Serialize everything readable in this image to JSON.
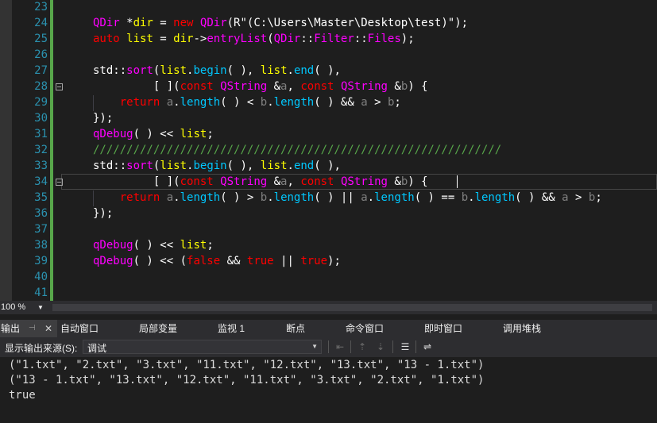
{
  "editor": {
    "line_numbers": [
      "23",
      "24",
      "25",
      "26",
      "27",
      "28",
      "29",
      "30",
      "31",
      "32",
      "33",
      "34",
      "35",
      "36",
      "37",
      "38",
      "39",
      "40",
      "41"
    ],
    "fold_lines": [
      "28",
      "34"
    ]
  },
  "zoom": {
    "value": "100 %"
  },
  "panel_tabs": {
    "output": "输出",
    "autos": "自动窗口",
    "locals": "局部变量",
    "watch1": "监视 1",
    "breakpoints": "断点",
    "command": "命令窗口",
    "immediate": "即时窗口",
    "callstack": "调用堆栈"
  },
  "output_toolbar": {
    "source_label": "显示输出来源(S):",
    "source_value": "调试"
  },
  "output_lines": [
    "(\"1.txt\", \"2.txt\", \"3.txt\", \"11.txt\", \"12.txt\", \"13.txt\", \"13 - 1.txt\")",
    "(\"13 - 1.txt\", \"13.txt\", \"12.txt\", \"11.txt\", \"3.txt\", \"2.txt\", \"1.txt\")",
    "true"
  ],
  "colors": {
    "background": "#1e1e1e",
    "keyword": "#ff0000",
    "type": "#ff00ff",
    "function": "#00c8ff",
    "variable": "#ffff00",
    "parameter": "#808080",
    "comment": "#57a64a",
    "line_number": "#2b91af"
  },
  "code": {
    "l24": {
      "t1": "QDir",
      "t2": " *",
      "t3": "dir",
      "t4": " = ",
      "t5": "new",
      "t6": " ",
      "t7": "QDir",
      "t8": "(R\"(C:\\Users\\Master\\Desktop\\test)\");"
    },
    "l25": {
      "t1": "auto",
      "t2": " ",
      "t3": "list",
      "t4": " = ",
      "t5": "dir",
      "t6": "->",
      "t7": "entryList",
      "t8": "(",
      "t9": "QDir",
      "t10": "::",
      "t11": "Filter",
      "t12": "::",
      "t13": "Files",
      "t14": ");"
    },
    "l27": {
      "t1": "std",
      "t2": "::",
      "t3": "sort",
      "t4": "(",
      "t5": "list",
      "t6": ".",
      "t7": "begin",
      "t8": "( ), ",
      "t9": "list",
      "t10": ".",
      "t11": "end",
      "t12": "( ),"
    },
    "l28": {
      "t1": "         [ ](",
      "t2": "const",
      "t3": " ",
      "t4": "QString",
      "t5": " &",
      "t6": "a",
      "t7": ", ",
      "t8": "const",
      "t9": " ",
      "t10": "QString",
      "t11": " &",
      "t12": "b",
      "t13": ") {"
    },
    "l29": {
      "t1": "    ",
      "t2": "return",
      "t3": " ",
      "t4": "a",
      "t5": ".",
      "t6": "length",
      "t7": "( ) < ",
      "t8": "b",
      "t9": ".",
      "t10": "length",
      "t11": "( ) && ",
      "t12": "a",
      "t13": " > ",
      "t14": "b",
      "t15": ";"
    },
    "l30": {
      "t1": "});"
    },
    "l31": {
      "t1": "qDebug",
      "t2": "( ) << ",
      "t3": "list",
      "t4": ";"
    },
    "l32": {
      "t1": "/////////////////////////////////////////////////////////////"
    },
    "l33": {
      "t1": "std",
      "t2": "::",
      "t3": "sort",
      "t4": "(",
      "t5": "list",
      "t6": ".",
      "t7": "begin",
      "t8": "( ), ",
      "t9": "list",
      "t10": ".",
      "t11": "end",
      "t12": "( ),"
    },
    "l34": {
      "t1": "         [ ](",
      "t2": "const",
      "t3": " ",
      "t4": "QString",
      "t5": " &",
      "t6": "a",
      "t7": ", ",
      "t8": "const",
      "t9": " ",
      "t10": "QString",
      "t11": " &",
      "t12": "b",
      "t13": ") {"
    },
    "l35": {
      "t1": "    ",
      "t2": "return",
      "t3": " ",
      "t4": "a",
      "t5": ".",
      "t6": "length",
      "t7": "( ) > ",
      "t8": "b",
      "t9": ".",
      "t10": "length",
      "t11": "( ) || ",
      "t12": "a",
      "t13": ".",
      "t14": "length",
      "t15": "( ) == ",
      "t16": "b",
      "t17": ".",
      "t18": "length",
      "t19": "( ) && ",
      "t20": "a",
      "t21": " > ",
      "t22": "b",
      "t23": ";"
    },
    "l36": {
      "t1": "});"
    },
    "l38": {
      "t1": "qDebug",
      "t2": "( ) << ",
      "t3": "list",
      "t4": ";"
    },
    "l39": {
      "t1": "qDebug",
      "t2": "( ) << (",
      "t3": "false",
      "t4": " && ",
      "t5": "true",
      "t6": " || ",
      "t7": "true",
      "t8": ");"
    }
  }
}
